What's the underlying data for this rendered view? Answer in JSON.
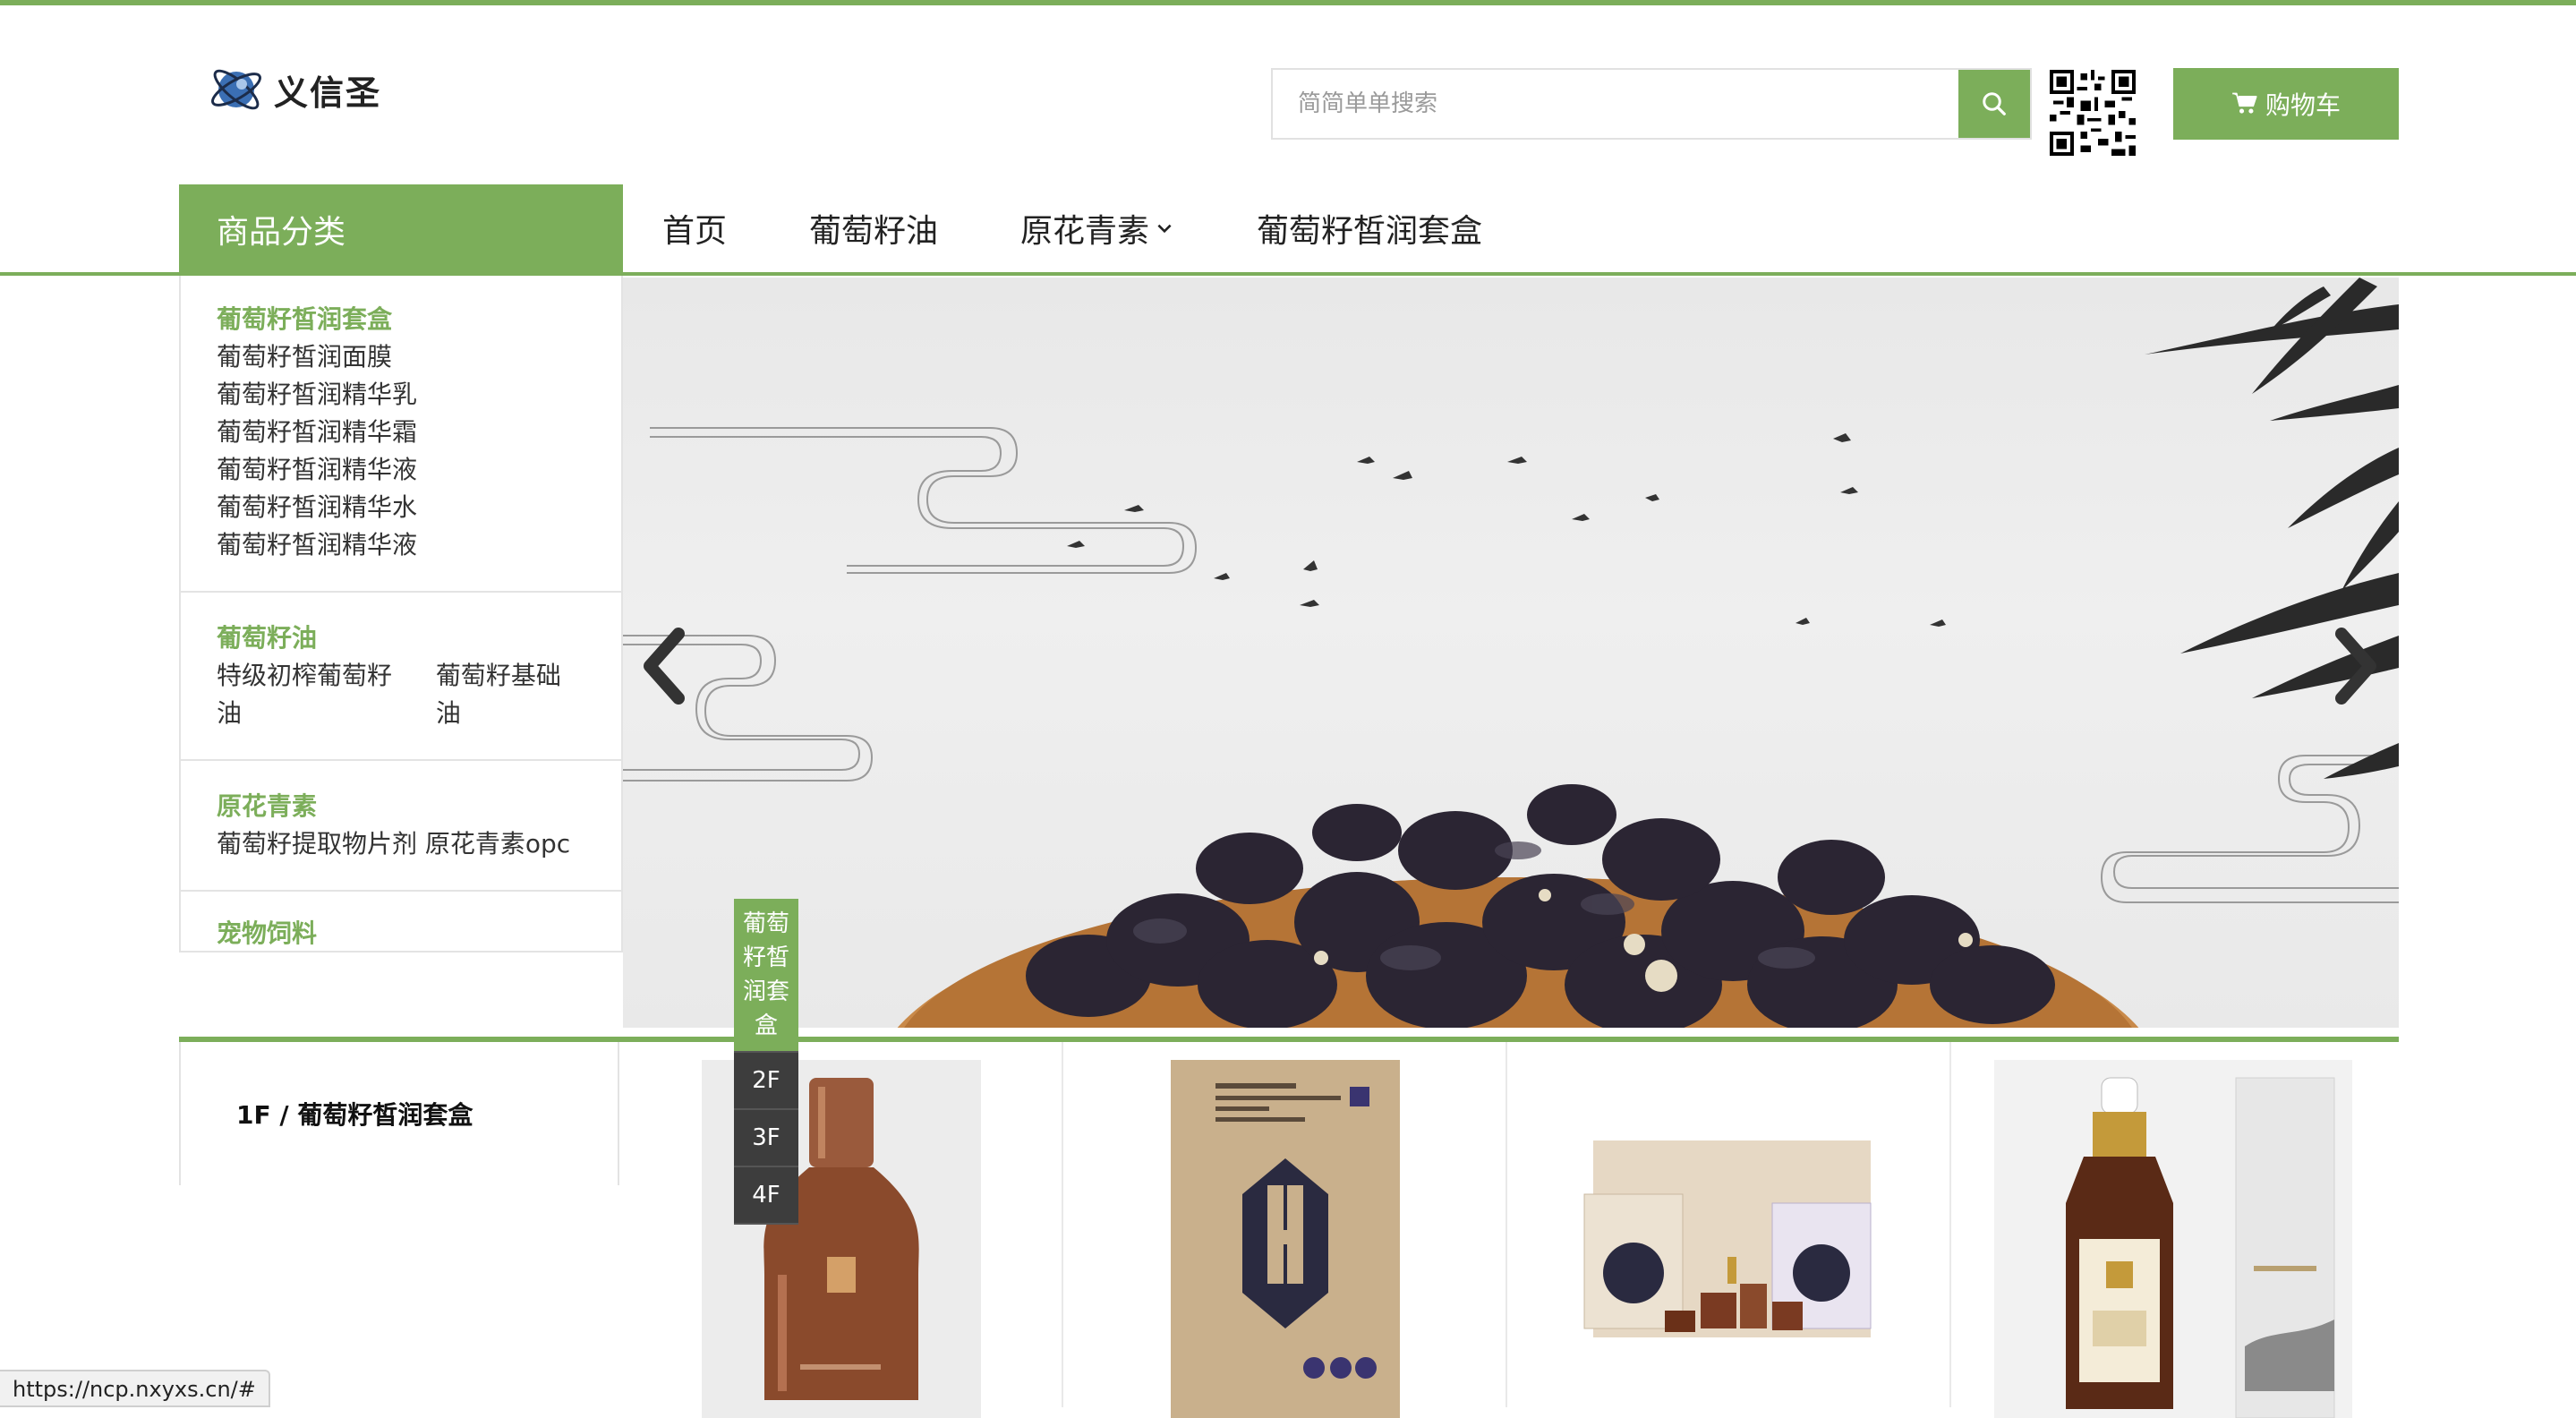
{
  "brand": {
    "name": "义信圣"
  },
  "search": {
    "placeholder": "简简单单搜索"
  },
  "cart": {
    "label": "购物车"
  },
  "nav": {
    "category_header": "商品分类",
    "items": [
      "首页",
      "葡萄籽油",
      "原花青素",
      "葡萄籽皙润套盒"
    ]
  },
  "categories": [
    {
      "title": "葡萄籽皙润套盒",
      "links": [
        "葡萄籽皙润面膜",
        "葡萄籽皙润精华乳",
        "葡萄籽皙润精华霜",
        "葡萄籽皙润精华液",
        "葡萄籽皙润精华水",
        "葡萄籽皙润精华液"
      ]
    },
    {
      "title": "葡萄籽油",
      "links": [
        "特级初榨葡萄籽油",
        "葡萄籽基础油"
      ]
    },
    {
      "title": "原花青素",
      "links": [
        "葡萄籽提取物片剂 原花青素opc"
      ]
    },
    {
      "title": "宠物饲料",
      "links": []
    }
  ],
  "floor": {
    "title": "1F / 葡萄籽皙润套盒"
  },
  "floor_nav": {
    "active": [
      "葡萄",
      "籽皙",
      "润套",
      "盒"
    ],
    "tabs": [
      "2F",
      "3F",
      "4F"
    ]
  },
  "status": {
    "url": "https://ncp.nxyxs.cn/#"
  },
  "colors": {
    "accent": "#7cae5a",
    "dark_tab": "#3d3d3d"
  }
}
